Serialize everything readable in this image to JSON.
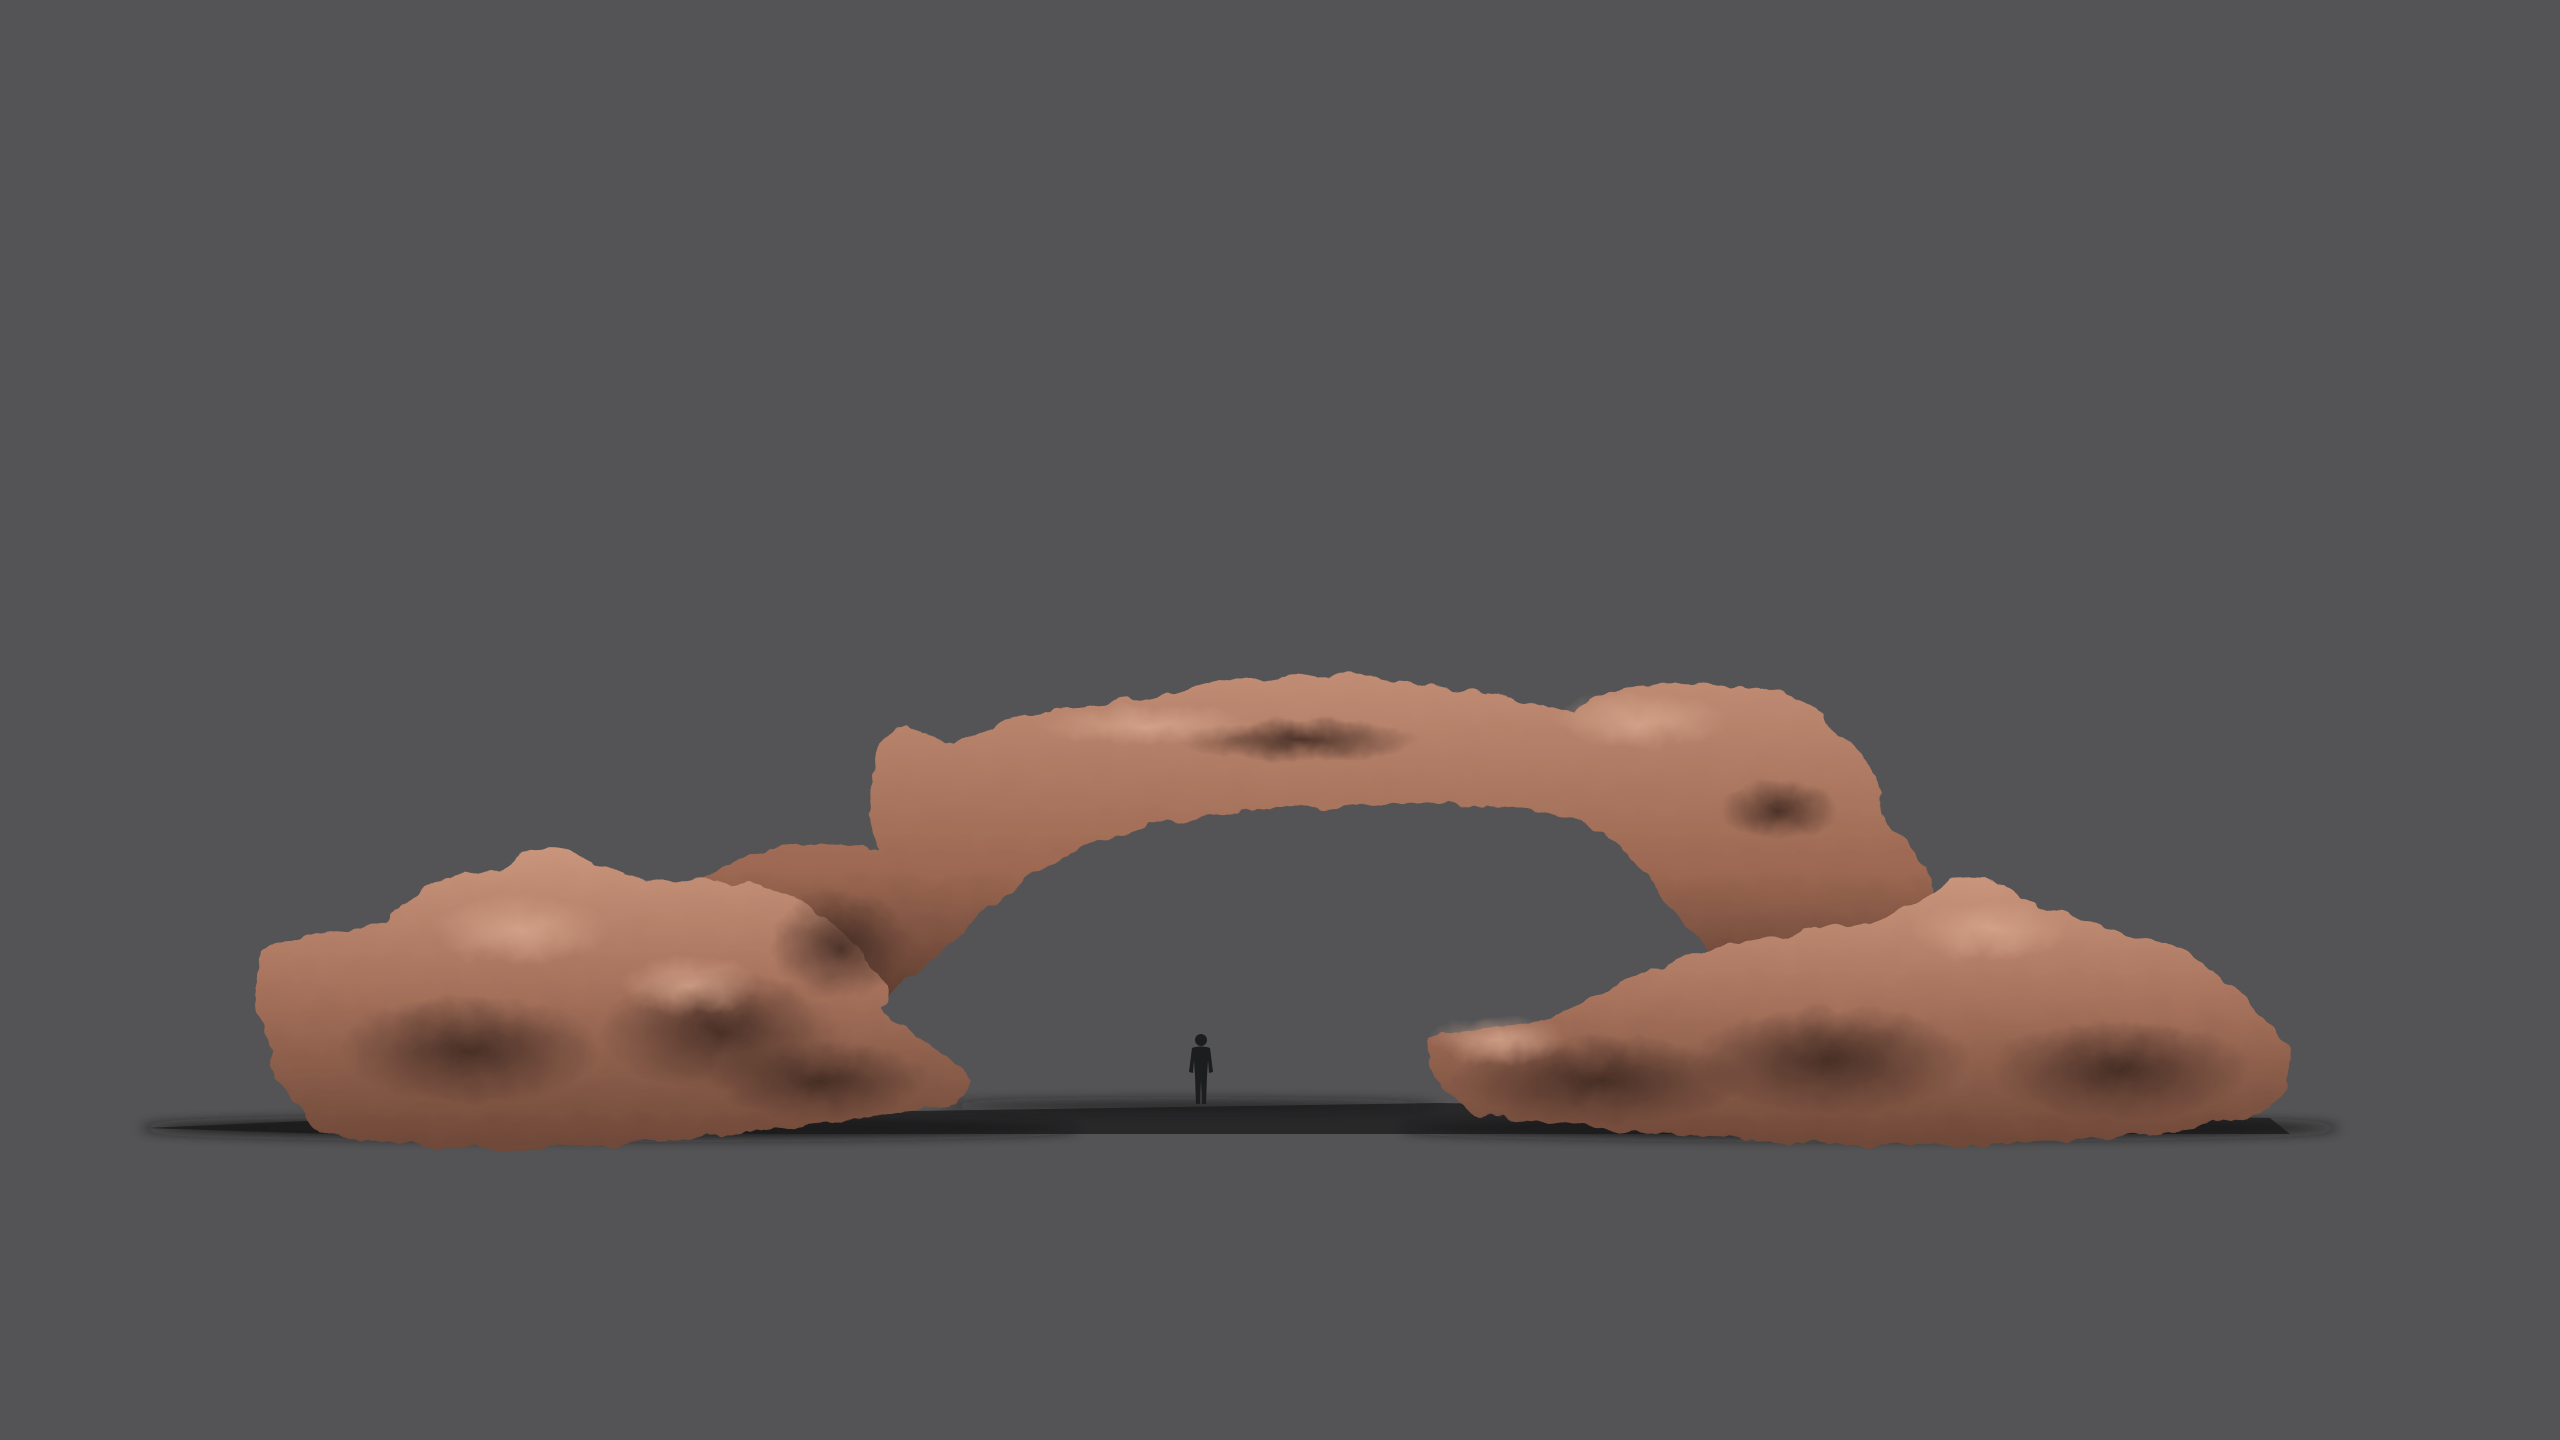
{
  "scene": {
    "background_color": "#545456",
    "rock_base_color": "#9a6a55",
    "rock_highlight_color": "#c9957c",
    "rock_shadow_color": "#4a3128",
    "ground_shadow_color": "#141414",
    "figure_color": "#1c1d1f",
    "objects": [
      "rock-arch",
      "human-figure-silhouette",
      "ground-shadow"
    ]
  }
}
